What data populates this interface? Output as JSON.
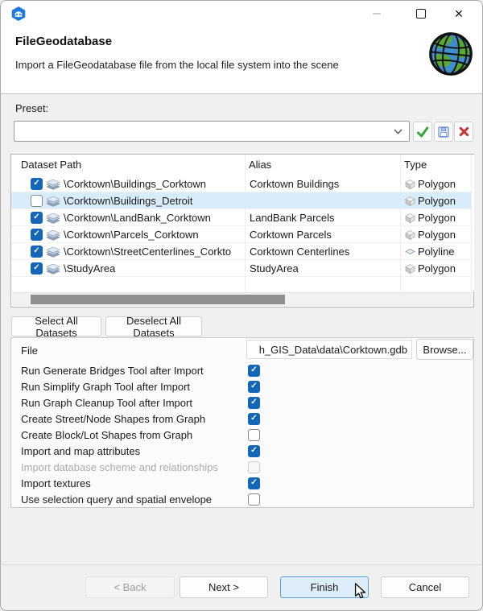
{
  "colors": {
    "accent": "#1467b8",
    "selection": "#d9ecfa",
    "finish-bg": "#ddeefa",
    "finish-border": "#5ba1d8",
    "scroll-thumb": "#8f8f8f",
    "green": "#2fa83c",
    "red": "#cf3434",
    "ocean": "#3f8ecb",
    "land": "#58a832"
  },
  "header": {
    "title": "FileGeodatabase",
    "subtitle": "Import a FileGeodatabase file from the local file system into the scene"
  },
  "preset": {
    "label": "Preset:",
    "value": "",
    "icons": [
      "apply-icon",
      "save-icon",
      "delete-icon"
    ]
  },
  "table": {
    "columns": [
      "Dataset Path",
      "Alias",
      "Type"
    ],
    "rows": [
      {
        "checked": true,
        "selected": false,
        "path": "\\Corktown\\Buildings_Corktown",
        "alias": "Corktown Buildings",
        "type": "Polygon"
      },
      {
        "checked": false,
        "selected": true,
        "path": "\\Corktown\\Buildings_Detroit",
        "alias": "",
        "type": "Polygon"
      },
      {
        "checked": true,
        "selected": false,
        "path": "\\Corktown\\LandBank_Corktown",
        "alias": "LandBank Parcels",
        "type": "Polygon"
      },
      {
        "checked": true,
        "selected": false,
        "path": "\\Corktown\\Parcels_Corktown",
        "alias": "Corktown Parcels",
        "type": "Polygon"
      },
      {
        "checked": true,
        "selected": false,
        "path": "\\Corktown\\StreetCenterlines_Corkto",
        "alias": "Corktown Centerlines",
        "type": "Polyline"
      },
      {
        "checked": true,
        "selected": false,
        "path": "\\StudyArea",
        "alias": "StudyArea",
        "type": "Polygon"
      }
    ]
  },
  "actions": {
    "select_all": "Select All Datasets",
    "deselect_all": "Deselect All Datasets"
  },
  "form": {
    "file_label": "File",
    "file_value": "h_GIS_Data\\data\\Corktown.gdb",
    "browse": "Browse...",
    "options": [
      {
        "label": "Run Generate Bridges Tool after Import",
        "checked": true,
        "enabled": true
      },
      {
        "label": "Run Simplify Graph Tool after Import",
        "checked": true,
        "enabled": true
      },
      {
        "label": "Run Graph Cleanup Tool after Import",
        "checked": true,
        "enabled": true
      },
      {
        "label": "Create Street/Node Shapes from Graph",
        "checked": true,
        "enabled": true
      },
      {
        "label": "Create Block/Lot Shapes from Graph",
        "checked": false,
        "enabled": true
      },
      {
        "label": "Import and map attributes",
        "checked": true,
        "enabled": true
      },
      {
        "label": "Import database scheme and relationships",
        "checked": false,
        "enabled": false
      },
      {
        "label": "Import textures",
        "checked": true,
        "enabled": true
      },
      {
        "label": "Use selection query and spatial envelope",
        "checked": false,
        "enabled": true
      }
    ]
  },
  "footer": {
    "back": "< Back",
    "next": "Next >",
    "finish": "Finish",
    "cancel": "Cancel"
  }
}
